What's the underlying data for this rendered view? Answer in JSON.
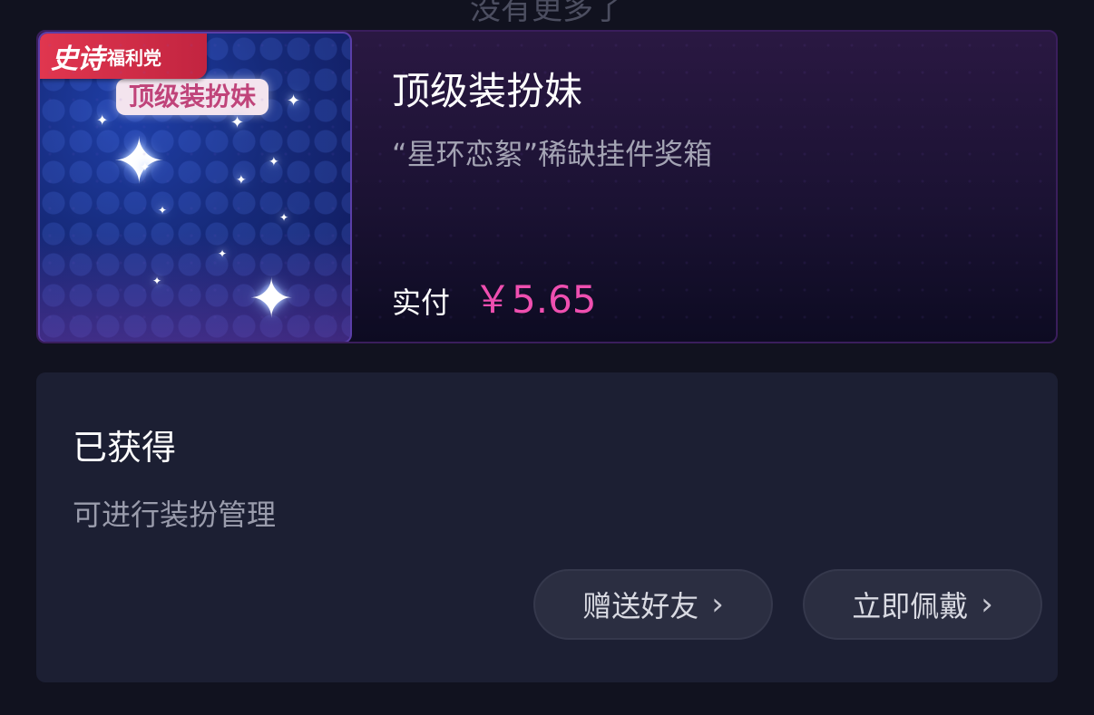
{
  "top_hint": "没有更多了",
  "product": {
    "badge_main": "史诗",
    "badge_sub": "福利党",
    "thumb_label": "顶级装扮妹",
    "title": "顶级装扮妹",
    "subtitle": "“星环恋絮”稀缺挂件奖箱",
    "price_label": "实付",
    "price_value": "￥5.65",
    "colors": {
      "price": "#ef4fb0",
      "badge": "#e0364f"
    }
  },
  "obtained": {
    "title": "已获得",
    "description": "可进行装扮管理",
    "gift_button": "赠送好友",
    "wear_button": "立即佩戴",
    "chevron_icon": "chevron-right-icon"
  }
}
